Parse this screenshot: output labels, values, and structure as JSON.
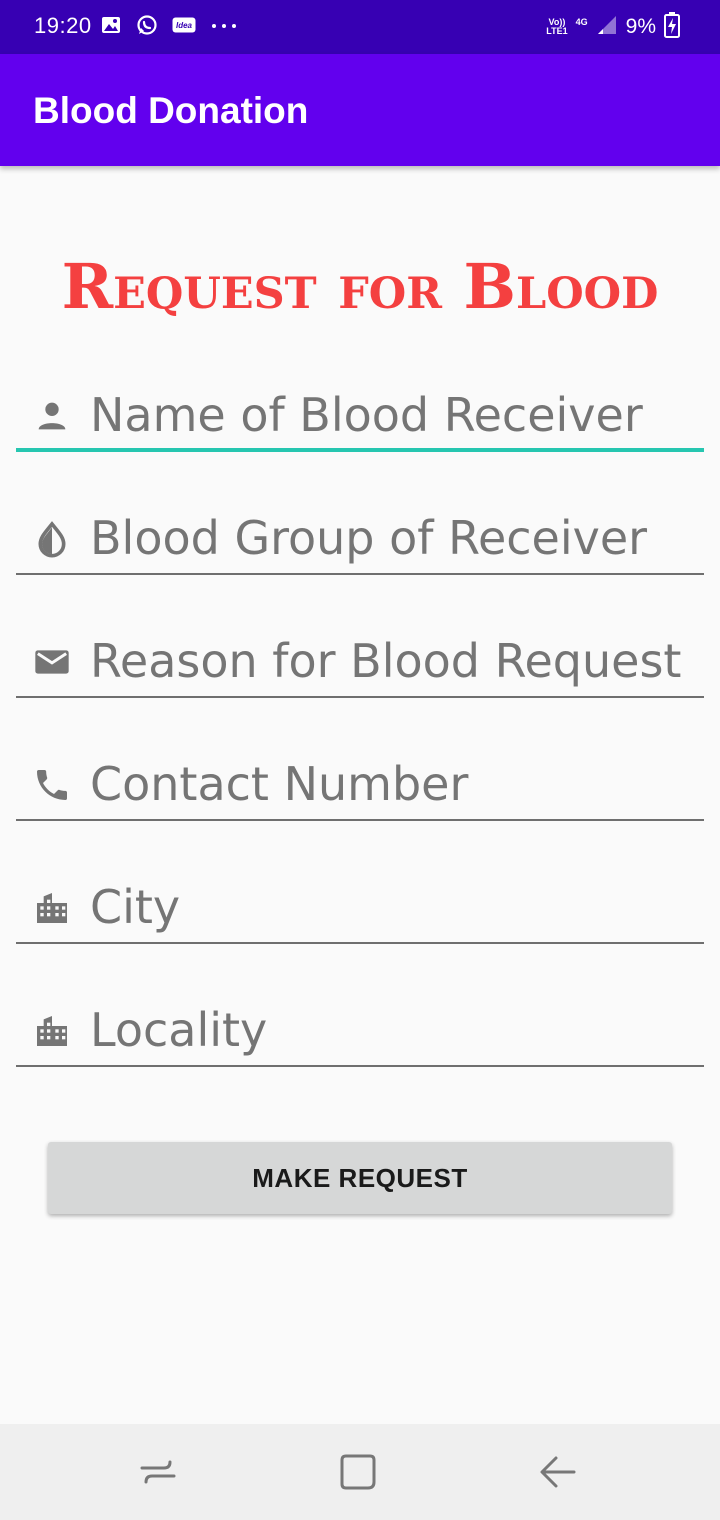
{
  "status_bar": {
    "time": "19:20",
    "left_icons": [
      "gallery-icon",
      "whatsapp-icon",
      "idea-icon",
      "more-dots-icon"
    ],
    "idea_label": "Idea",
    "network_top": "Vo))",
    "network_bottom": "LTE1",
    "network_type": "4G",
    "battery_percent": "9%"
  },
  "app_bar": {
    "title": "Blood Donation"
  },
  "form": {
    "heading": "Request for Blood",
    "fields": [
      {
        "placeholder": "Name of Blood Receiver",
        "icon": "person-icon",
        "active": true
      },
      {
        "placeholder": "Blood Group of Receiver",
        "icon": "blood-drop-icon",
        "active": false
      },
      {
        "placeholder": "Reason for Blood Request",
        "icon": "mail-icon",
        "active": false
      },
      {
        "placeholder": "Contact Number",
        "icon": "phone-icon",
        "active": false
      },
      {
        "placeholder": "City",
        "icon": "city-icon",
        "active": false
      },
      {
        "placeholder": "Locality",
        "icon": "city-icon",
        "active": false
      }
    ],
    "submit_label": "MAKE REQUEST"
  },
  "nav_bar": {
    "buttons": [
      "recent-apps-icon",
      "home-icon",
      "back-icon"
    ]
  },
  "colors": {
    "status_bar": "#3700b3",
    "app_bar": "#6200ee",
    "heading": "#f44040",
    "active_underline": "#26c6b0",
    "button_bg": "#d6d7d7"
  }
}
